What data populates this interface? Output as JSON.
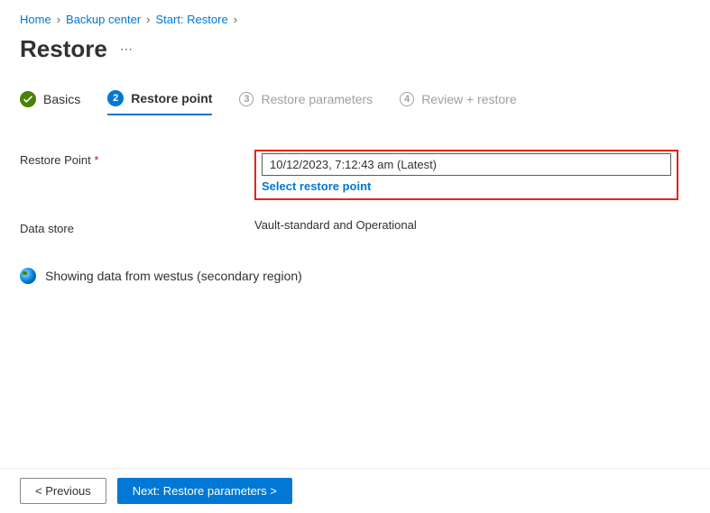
{
  "breadcrumb": [
    {
      "label": "Home"
    },
    {
      "label": "Backup center"
    },
    {
      "label": "Start: Restore"
    }
  ],
  "page": {
    "title": "Restore"
  },
  "tabs": {
    "basics": "Basics",
    "restore_point": "Restore point",
    "restore_parameters": "Restore parameters",
    "review": "Review + restore",
    "step3_num": "3",
    "step4_num": "4",
    "step2_num": "2"
  },
  "form": {
    "restore_point_label": "Restore Point",
    "restore_point_value": "10/12/2023, 7:12:43 am (Latest)",
    "select_restore_point": "Select restore point",
    "data_store_label": "Data store",
    "data_store_value": "Vault-standard and Operational",
    "region_message": "Showing data from westus (secondary region)"
  },
  "footer": {
    "previous": "< Previous",
    "next": "Next: Restore parameters >"
  }
}
